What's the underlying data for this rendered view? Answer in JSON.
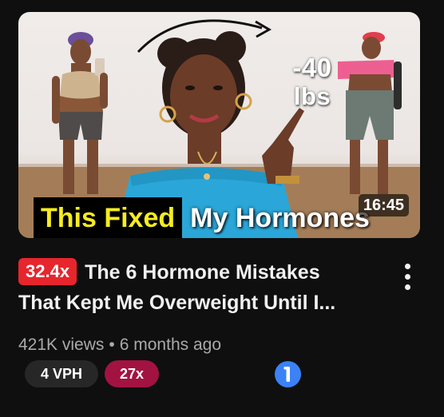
{
  "video": {
    "thumbnail": {
      "overlay_line1": "-40",
      "overlay_line2": "lbs",
      "caption_highlight": "This Fixed",
      "caption_rest": "My Hormones",
      "duration": "16:45"
    },
    "outlier_score": "32.4x",
    "title_line1": "The 6 Hormone Mistakes",
    "title_line2": "That Kept Me Overweight Until I...",
    "views": "421K views",
    "separator": "•",
    "age": "6 months ago",
    "chips": {
      "vph": "4 VPH",
      "multiplier": "27x"
    },
    "icons": {
      "more": "more-vert-icon",
      "info": "info-badge-icon"
    },
    "colors": {
      "outlier_badge": "#e7252d",
      "multiplier_chip": "#a21342",
      "vph_chip": "#272727",
      "info_badge": "#3b82f6",
      "caption_highlight": "#f6ec1f"
    }
  }
}
